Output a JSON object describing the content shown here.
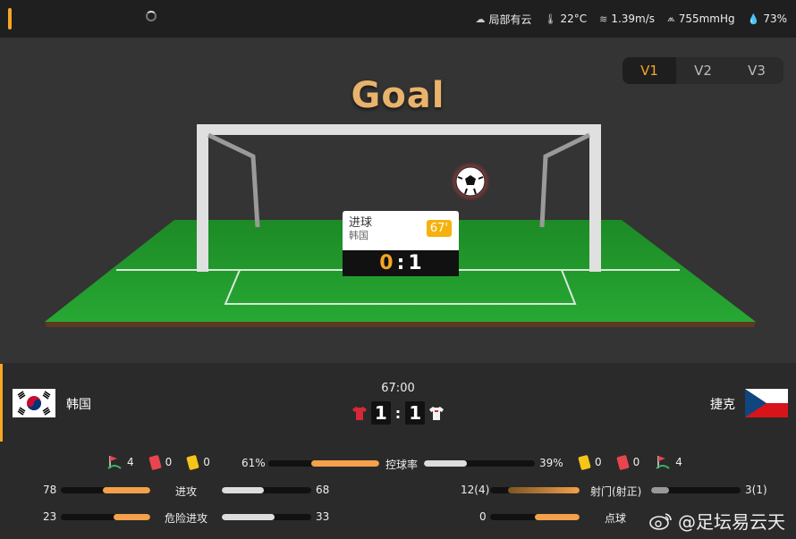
{
  "weather": {
    "condition": "局部有云",
    "temperature": "22°C",
    "wind": "1.39m/s",
    "pressure": "755mmHg",
    "humidity": "73%"
  },
  "versions": [
    "V1",
    "V2",
    "V3"
  ],
  "active_version": "V1",
  "animation": {
    "title": "Goal",
    "event_label": "进球",
    "event_team": "韩国",
    "event_minute": "67'",
    "score_home": "0",
    "score_away": "1"
  },
  "match": {
    "home_team": "韩国",
    "away_team": "捷克",
    "time": "67:00",
    "home_score": "1",
    "away_score": "1"
  },
  "stats": {
    "home_corners": "4",
    "home_red": "0",
    "home_yellow": "0",
    "away_yellow": "0",
    "away_red": "0",
    "away_corners": "4",
    "possession_label": "控球率",
    "possession_home": "61%",
    "possession_away": "39%",
    "possession_home_value": 61,
    "possession_away_value": 39,
    "attack_label": "进攻",
    "attack_home": "78",
    "attack_away": "68",
    "attack_home_value": 78,
    "attack_away_value": 68,
    "danger_label": "危险进攻",
    "danger_home": "23",
    "danger_away": "33",
    "danger_home_value": 23,
    "danger_away_value": 33,
    "shots_label": "射门(射正)",
    "shots_home": "12(4)",
    "shots_away": "3(1)",
    "shots_home_value": 12,
    "shots_away_value": 3,
    "penalty_label": "点球",
    "penalty_home": "0",
    "penalty_away": "0"
  },
  "watermark": "@足坛易云天",
  "colors": {
    "accent": "#f5a623",
    "pitch": "#1f9a2c",
    "bar_fill": "#f5a04b"
  }
}
